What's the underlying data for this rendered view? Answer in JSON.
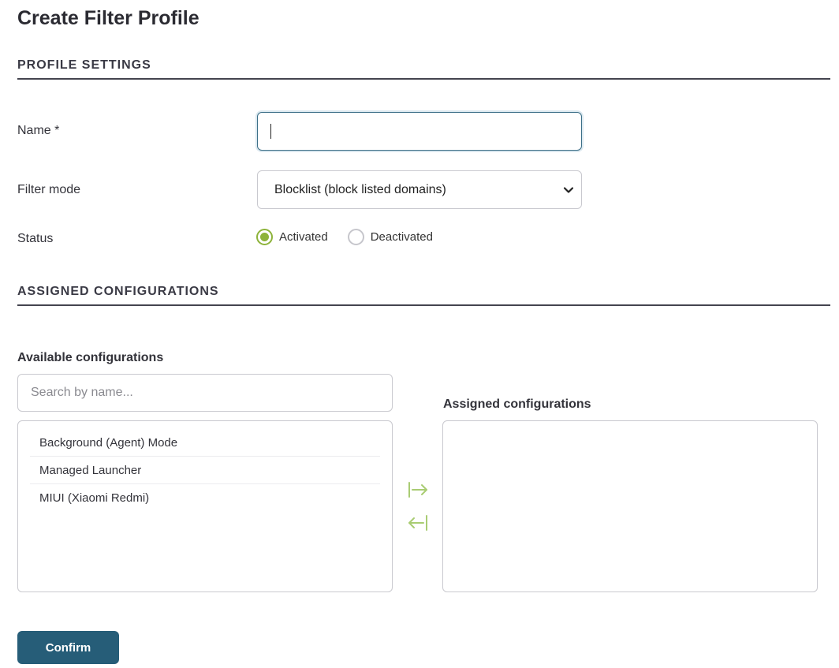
{
  "page": {
    "title": "Create Filter Profile"
  },
  "sections": {
    "profile_settings": "PROFILE SETTINGS",
    "assigned_configurations": "ASSIGNED CONFIGURATIONS"
  },
  "form": {
    "name_label": "Name *",
    "name_value": "",
    "filter_mode_label": "Filter mode",
    "filter_mode_selected": "Blocklist (block listed domains)",
    "status_label": "Status",
    "status_options": [
      "Activated",
      "Deactivated"
    ],
    "status_selected": "Activated"
  },
  "available": {
    "title": "Available configurations",
    "search_placeholder": "Search by name...",
    "items": [
      "Background (Agent) Mode",
      "Managed Launcher",
      "MIUI (Xiaomi Redmi)"
    ]
  },
  "assigned": {
    "title": "Assigned configurations",
    "items": []
  },
  "controls": {
    "move_right_icon": "arrow-right-to-bar-icon",
    "move_left_icon": "arrow-left-to-bar-icon",
    "confirm_label": "Confirm"
  },
  "colors": {
    "accent_green": "#8db33a",
    "primary_button": "#265d78",
    "focus_border": "#3d6f88",
    "arrow_green": "#a9cc73"
  }
}
